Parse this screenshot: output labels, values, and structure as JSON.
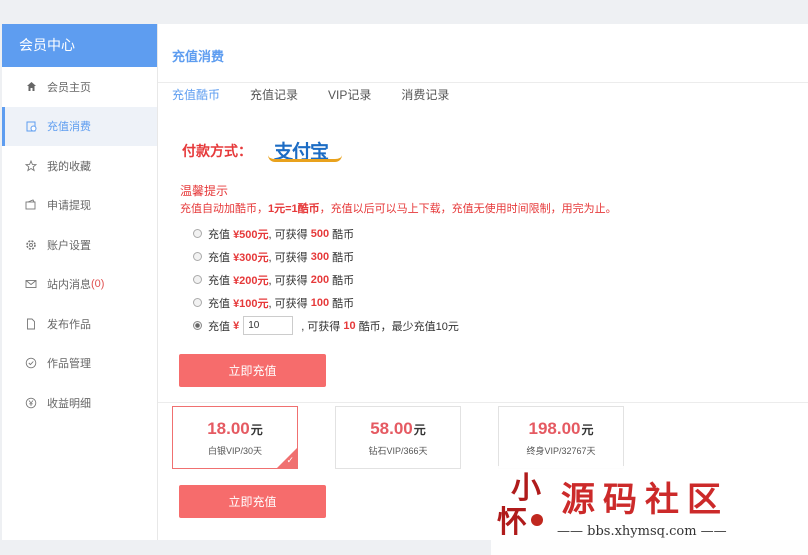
{
  "sidebar": {
    "title": "会员中心",
    "items": [
      {
        "label": "会员主页",
        "icon": "home-icon",
        "active": false
      },
      {
        "label": "充值消费",
        "icon": "recharge-icon",
        "active": true
      },
      {
        "label": "我的收藏",
        "icon": "star-icon",
        "active": false
      },
      {
        "label": "申请提现",
        "icon": "wallet-icon",
        "active": false
      },
      {
        "label": "账户设置",
        "icon": "gear-icon",
        "active": false
      },
      {
        "label": "站内消息",
        "count": "(0)",
        "icon": "mail-icon",
        "active": false
      },
      {
        "label": "发布作品",
        "icon": "document-icon",
        "active": false
      },
      {
        "label": "作品管理",
        "icon": "check-circle-icon",
        "active": false
      },
      {
        "label": "收益明细",
        "icon": "yen-circle-icon",
        "active": false
      }
    ]
  },
  "main": {
    "title": "充值消费",
    "tabs": [
      {
        "label": "充值酷币",
        "active": true
      },
      {
        "label": "充值记录",
        "active": false
      },
      {
        "label": "VIP记录",
        "active": false
      },
      {
        "label": "消费记录",
        "active": false
      }
    ],
    "payment": {
      "label": "付款方式：",
      "logo_text": "支付宝"
    },
    "notice": {
      "title": "温馨提示",
      "text_parts": [
        "充值自动加酷币，",
        "1元=1酷币",
        "，充值以后可以马上下载，充值无使用时间限制，用完为止。"
      ]
    },
    "options": [
      {
        "prefix": "充值",
        "amount": "¥500元",
        "mid": ", 可获得",
        "coins": "500",
        "suffix": "酷币",
        "checked": false
      },
      {
        "prefix": "充值",
        "amount": "¥300元",
        "mid": ", 可获得",
        "coins": "300",
        "suffix": "酷币",
        "checked": false
      },
      {
        "prefix": "充值",
        "amount": "¥200元",
        "mid": ", 可获得",
        "coins": "200",
        "suffix": "酷币",
        "checked": false
      },
      {
        "prefix": "充值",
        "amount": "¥100元",
        "mid": ", 可获得",
        "coins": "100",
        "suffix": "酷币",
        "checked": false
      }
    ],
    "custom_option": {
      "prefix": "充值",
      "currency": "¥",
      "input_value": "10",
      "mid": ", 可获得",
      "coins": "10",
      "suffix": "酷币，最少充值10元",
      "checked": true
    },
    "recharge_button": "立即充值",
    "vip_plans": [
      {
        "price": "18.00",
        "unit": "元",
        "name": "白银VIP/30天",
        "selected": true
      },
      {
        "price": "58.00",
        "unit": "元",
        "name": "钻石VIP/366天",
        "selected": false
      },
      {
        "price": "198.00",
        "unit": "元",
        "name": "终身VIP/32767天",
        "selected": false
      }
    ],
    "vip_button": "立即充值"
  },
  "watermark": {
    "seal": "小怀",
    "title": "源码社区",
    "url": "—— bbs.xhymsq.com ——"
  },
  "colors": {
    "accent": "#5e9df0",
    "price_red": "#e6393a",
    "button": "#f66c6c"
  }
}
